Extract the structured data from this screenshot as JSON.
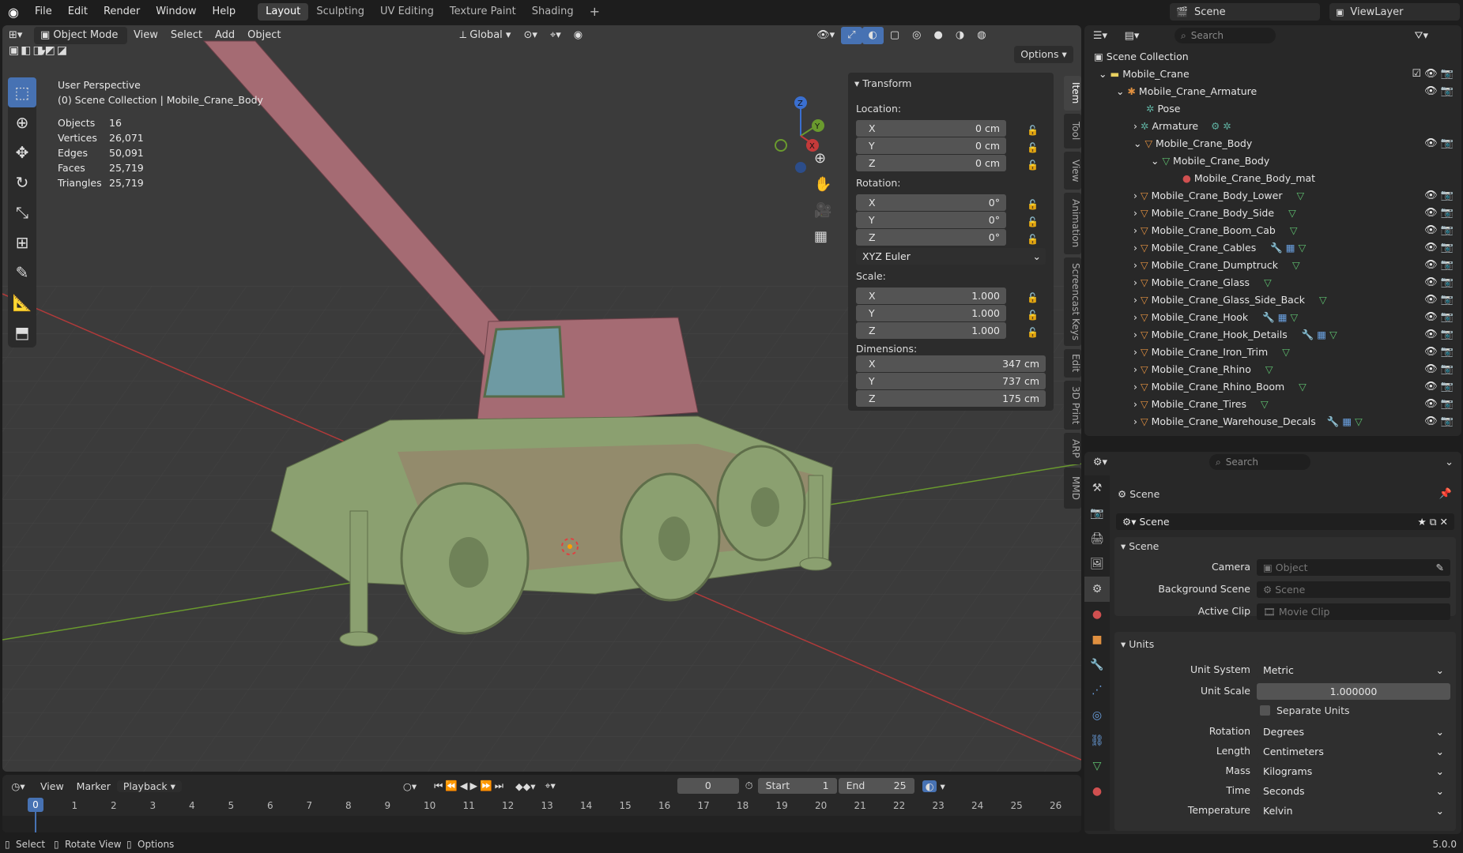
{
  "topbar": {
    "menus": [
      "File",
      "Edit",
      "Render",
      "Window",
      "Help"
    ],
    "workspaces": [
      "Layout",
      "Sculpting",
      "UV Editing",
      "Texture Paint",
      "Shading"
    ],
    "active_workspace": "Layout",
    "scene": "Scene",
    "view_layer": "ViewLayer"
  },
  "viewport": {
    "mode": "Object Mode",
    "menus": [
      "View",
      "Select",
      "Add",
      "Object"
    ],
    "transform_orientation": "Global",
    "options_label": "Options",
    "overlay": {
      "perspective": "User Perspective",
      "collection": "(0) Scene Collection | Mobile_Crane_Body",
      "stats": [
        {
          "label": "Objects",
          "value": "16"
        },
        {
          "label": "Vertices",
          "value": "26,071"
        },
        {
          "label": "Edges",
          "value": "50,091"
        },
        {
          "label": "Faces",
          "value": "25,719"
        },
        {
          "label": "Triangles",
          "value": "25,719"
        }
      ]
    },
    "gizmo": {
      "x": "X",
      "y": "Y",
      "z": "Z"
    }
  },
  "npanel": {
    "title": "Transform",
    "location_label": "Location:",
    "location": [
      {
        "axis": "X",
        "value": "0 cm"
      },
      {
        "axis": "Y",
        "value": "0 cm"
      },
      {
        "axis": "Z",
        "value": "0 cm"
      }
    ],
    "rotation_label": "Rotation:",
    "rotation": [
      {
        "axis": "X",
        "value": "0°"
      },
      {
        "axis": "Y",
        "value": "0°"
      },
      {
        "axis": "Z",
        "value": "0°"
      }
    ],
    "rotation_mode": "XYZ Euler",
    "scale_label": "Scale:",
    "scale": [
      {
        "axis": "X",
        "value": "1.000"
      },
      {
        "axis": "Y",
        "value": "1.000"
      },
      {
        "axis": "Z",
        "value": "1.000"
      }
    ],
    "dimensions_label": "Dimensions:",
    "dimensions": [
      {
        "axis": "X",
        "value": "347 cm"
      },
      {
        "axis": "Y",
        "value": "737 cm"
      },
      {
        "axis": "Z",
        "value": "175 cm"
      }
    ],
    "tabs": [
      "Item",
      "Tool",
      "View",
      "Animation",
      "Screencast Keys",
      "Edit",
      "3D Print",
      "ARP",
      "MMD"
    ]
  },
  "outliner": {
    "search_placeholder": "Search",
    "root": "Scene Collection",
    "items": [
      {
        "label": "Mobile_Crane",
        "kind": "collection"
      },
      {
        "label": "Mobile_Crane_Armature",
        "kind": "armature"
      },
      {
        "label": "Pose",
        "kind": "pose"
      },
      {
        "label": "Armature",
        "kind": "armature-data"
      },
      {
        "label": "Mobile_Crane_Body",
        "kind": "mesh"
      },
      {
        "label": "Mobile_Crane_Body",
        "kind": "mesh-data"
      },
      {
        "label": "Mobile_Crane_Body_mat",
        "kind": "material"
      },
      {
        "label": "Mobile_Crane_Body_Lower",
        "kind": "mesh"
      },
      {
        "label": "Mobile_Crane_Body_Side",
        "kind": "mesh"
      },
      {
        "label": "Mobile_Crane_Boom_Cab",
        "kind": "mesh"
      },
      {
        "label": "Mobile_Crane_Cables",
        "kind": "mesh"
      },
      {
        "label": "Mobile_Crane_Dumptruck",
        "kind": "mesh"
      },
      {
        "label": "Mobile_Crane_Glass",
        "kind": "mesh"
      },
      {
        "label": "Mobile_Crane_Glass_Side_Back",
        "kind": "mesh"
      },
      {
        "label": "Mobile_Crane_Hook",
        "kind": "mesh"
      },
      {
        "label": "Mobile_Crane_Hook_Details",
        "kind": "mesh"
      },
      {
        "label": "Mobile_Crane_Iron_Trim",
        "kind": "mesh"
      },
      {
        "label": "Mobile_Crane_Rhino",
        "kind": "mesh"
      },
      {
        "label": "Mobile_Crane_Rhino_Boom",
        "kind": "mesh"
      },
      {
        "label": "Mobile_Crane_Tires",
        "kind": "mesh"
      },
      {
        "label": "Mobile_Crane_Warehouse_Decals",
        "kind": "mesh"
      }
    ]
  },
  "properties": {
    "search_placeholder": "Search",
    "context": "Scene",
    "scene_name": "Scene",
    "scene_panel": "Scene",
    "camera_label": "Camera",
    "camera_placeholder": "Object",
    "bg_scene_label": "Background Scene",
    "bg_scene_placeholder": "Scene",
    "active_clip_label": "Active Clip",
    "active_clip_placeholder": "Movie Clip",
    "units_panel": "Units",
    "unit_system_label": "Unit System",
    "unit_system": "Metric",
    "unit_scale_label": "Unit Scale",
    "unit_scale": "1.000000",
    "separate_units": "Separate Units",
    "rotation_label": "Rotation",
    "rotation": "Degrees",
    "length_label": "Length",
    "length": "Centimeters",
    "mass_label": "Mass",
    "mass": "Kilograms",
    "time_label": "Time",
    "time": "Seconds",
    "temperature_label": "Temperature",
    "temperature": "Kelvin"
  },
  "timeline": {
    "menus": [
      "View",
      "Marker"
    ],
    "playback": "Playback",
    "current_frame": "0",
    "start_label": "Start",
    "start": "1",
    "end_label": "End",
    "end": "25",
    "ticks": [
      "0",
      "1",
      "2",
      "3",
      "4",
      "5",
      "6",
      "7",
      "8",
      "9",
      "10",
      "11",
      "12",
      "13",
      "14",
      "15",
      "16",
      "17",
      "18",
      "19",
      "20",
      "21",
      "22",
      "23",
      "24",
      "25",
      "26"
    ]
  },
  "statusbar": {
    "select": "Select",
    "rotate_view": "Rotate View",
    "options": "Options",
    "version": "5.0.0"
  },
  "colors": {
    "accent": "#4772b3",
    "body_pink": "#a56b73",
    "body_green": "#8ba070",
    "axis_red": "#c43a3a",
    "axis_green": "#6a9a2e"
  }
}
